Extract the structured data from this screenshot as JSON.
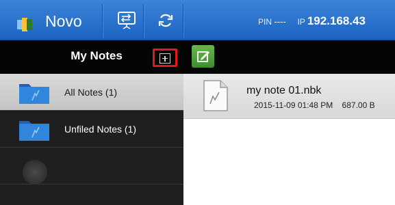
{
  "header": {
    "app_name": "Novo",
    "pin_label": "PIN",
    "pin_value": "----",
    "ip_label": "IP",
    "ip_value": "192.168.43"
  },
  "sidebar": {
    "title": "My Notes",
    "items": [
      {
        "label": "All Notes (1)",
        "selected": true,
        "icon": "folder-icon"
      },
      {
        "label": "Unfiled Notes (1)",
        "selected": false,
        "icon": "folder-icon"
      }
    ]
  },
  "files": [
    {
      "name": "my note 01.nbk",
      "date": "2015-11-09 01:48 PM",
      "size": "687.00 B",
      "icon": "note-file-icon"
    }
  ],
  "colors": {
    "header_blue": "#1c63c0",
    "highlight_red": "#e11b1b",
    "edit_green": "#4a9e37",
    "folder_blue": "#2f7fd6"
  }
}
